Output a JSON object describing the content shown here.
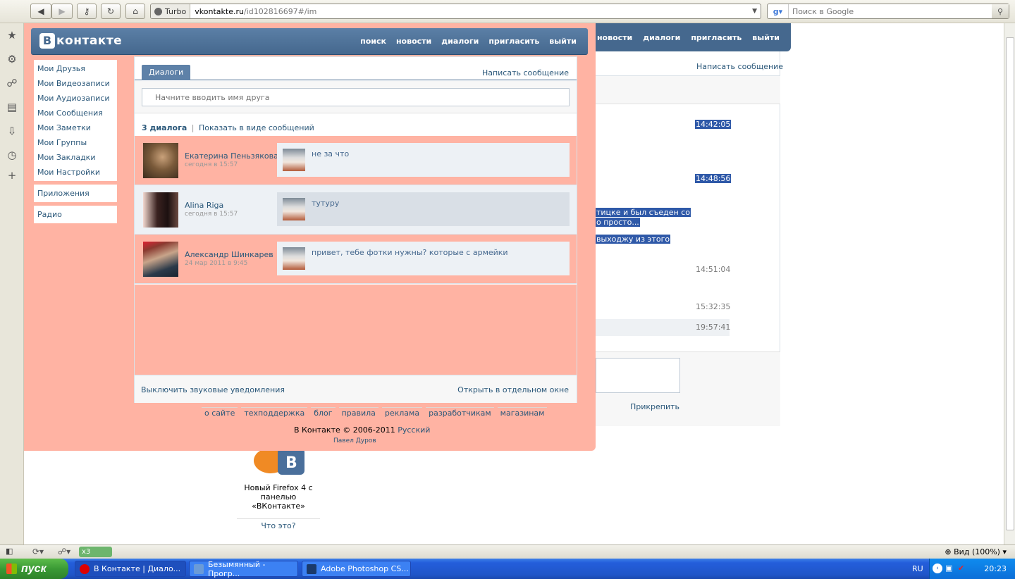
{
  "browser": {
    "turbo_label": "Turbo",
    "url_host": "vkontakte.ru",
    "url_path": "/id102816697#/im",
    "search_placeholder": "Поиск в Google",
    "zoom": "Вид (100%)",
    "extension_badge": "x3"
  },
  "vk": {
    "logo_letter": "В",
    "logo_text": "контакте",
    "nav": [
      "поиск",
      "новости",
      "диалоги",
      "пригласить",
      "выйти"
    ],
    "side_menu": [
      "Мои Друзья",
      "Мои Видеозаписи",
      "Мои Аудиозаписи",
      "Мои Сообщения",
      "Мои Заметки",
      "Мои Группы",
      "Мои Закладки",
      "Мои Настройки"
    ],
    "apps": "Приложения",
    "radio": "Радио",
    "tab": "Диалоги",
    "write_message": "Написать сообщение",
    "friend_search_placeholder": "Начните вводить имя друга",
    "dialog_count": "3 диалога",
    "separator": "|",
    "show_as_messages": "Показать в виде сообщений",
    "dialogs": [
      {
        "name": "Екатерина Пеньзякова",
        "date": "сегодня в 15:57",
        "message": "не за что"
      },
      {
        "name": "Alina Riga",
        "date": "сегодня в 15:57",
        "message": "тутуру"
      },
      {
        "name": "Александр Шинкарев",
        "date": "24 мар 2011 в 9:45",
        "message": "привет, тебе фотки нужны? которые с армейки"
      }
    ],
    "sound_off": "Выключить звуковые уведомления",
    "open_window": "Открыть в отдельном окне",
    "footer_links": [
      "о сайте",
      "техподдержка",
      "блог",
      "правила",
      "реклама",
      "разработчикам",
      "магазинам"
    ],
    "copyright": "В Контакте © 2006-2011",
    "language": "Русский",
    "author": "Павел Дуров"
  },
  "background_page": {
    "nav": [
      "новости",
      "диалоги",
      "пригласить",
      "выйти"
    ],
    "write_message": "Написать сообщение",
    "times": [
      "14:42:05",
      "14:48:56",
      "14:51:04",
      "15:32:35",
      "19:57:41"
    ],
    "selected_text": [
      "тицке и был съеден со",
      "о просто...",
      "выходжу из этого"
    ],
    "attach": "Прикрепить"
  },
  "promo": {
    "text": "Новый Firefox 4 с панелью «ВКонтакте»",
    "what": "Что это?"
  },
  "taskbar": {
    "start": "пуск",
    "tasks": [
      "В Контакте | Диало...",
      "Безымянный - Прогр...",
      "Adobe Photoshop CS..."
    ],
    "lang": "RU",
    "clock": "20:23"
  }
}
